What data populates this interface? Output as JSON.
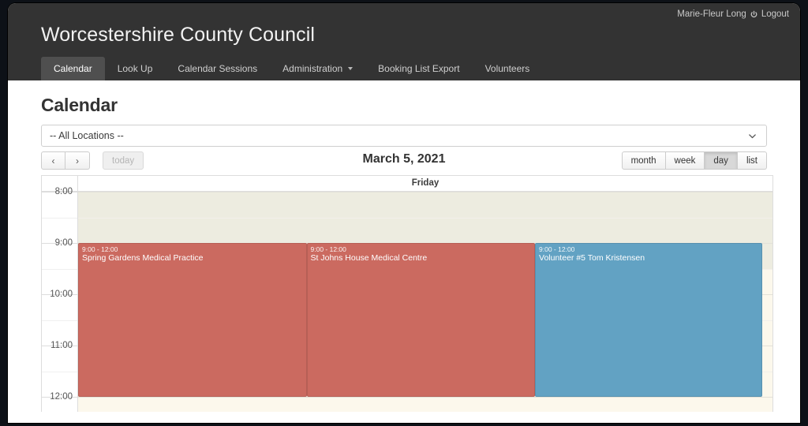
{
  "header": {
    "brand": "Worcestershire County Council",
    "user_name": "Marie-Fleur Long",
    "power_icon": "power-icon",
    "logout_label": "Logout",
    "nav": [
      {
        "label": "Calendar",
        "active": true,
        "caret": false
      },
      {
        "label": "Look Up",
        "active": false,
        "caret": false
      },
      {
        "label": "Calendar Sessions",
        "active": false,
        "caret": false
      },
      {
        "label": "Administration",
        "active": false,
        "caret": true
      },
      {
        "label": "Booking List Export",
        "active": false,
        "caret": false
      },
      {
        "label": "Volunteers",
        "active": false,
        "caret": false
      }
    ]
  },
  "page": {
    "title": "Calendar",
    "location_filter": {
      "selected": "-- All Locations --",
      "chevron_icon": "chevron-down-icon"
    }
  },
  "toolbar": {
    "prev_label": "‹",
    "next_label": "›",
    "today_label": "today",
    "title": "March 5, 2021",
    "views": [
      {
        "label": "month",
        "active": false
      },
      {
        "label": "week",
        "active": false
      },
      {
        "label": "day",
        "active": true
      },
      {
        "label": "list",
        "active": false
      }
    ]
  },
  "calendar": {
    "day_header": "Friday",
    "time_labels": [
      "8:00",
      "9:00",
      "10:00",
      "11:00",
      "12:00"
    ],
    "events": [
      {
        "time": "9:00 - 12:00",
        "title": "Spring Gardens Medical Practice",
        "color": "#cb6a60",
        "lane": 0
      },
      {
        "time": "9:00 - 12:00",
        "title": "St Johns House Medical Centre",
        "color": "#cb6a60",
        "lane": 1
      },
      {
        "time": "9:00 - 12:00",
        "title": "Volunteer #5 Tom Kristensen",
        "color": "#62a2c3",
        "lane": 2
      }
    ]
  },
  "colors": {
    "header_bg": "#333333",
    "event_red": "#cb6a60",
    "event_blue": "#62a2c3",
    "business_hours_bg": "#edece0",
    "nonbusiness_bg": "#fcf8ec"
  }
}
